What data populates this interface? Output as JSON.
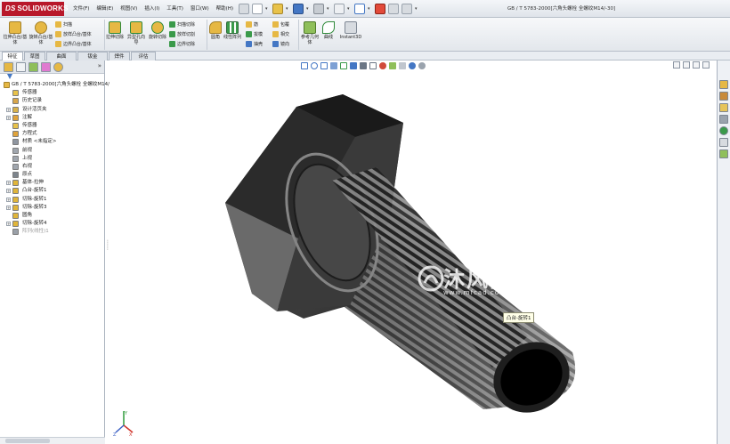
{
  "app": {
    "logo": "SOLIDWORKS",
    "logo_prefix": "DS",
    "window_title": "GB / T 5783-2000[六角头螺栓 全螺纹M14/-30]"
  },
  "menus": [
    "文件(F)",
    "编辑(E)",
    "视图(V)",
    "插入(I)",
    "工具(T)",
    "窗口(W)",
    "帮助(H)"
  ],
  "ribbon": {
    "extrude_boss": "拉伸凸台/基体",
    "revolve_boss": "旋转凸台/基体",
    "sweep": "扫描",
    "loft": "放样凸台/基体",
    "boundary_boss": "边界凸台/基体",
    "extrude_cut": "拉伸切除",
    "hole_wizard": "异型孔向导",
    "revolve_cut": "旋转切除",
    "swept_cut": "扫描切除",
    "lofted_cut": "放样切割",
    "boundary_cut": "边界切除",
    "fillet": "圆角",
    "linear_pattern": "线性阵列",
    "rib": "筋",
    "draft": "拔模",
    "shell": "抽壳",
    "wrap": "包覆",
    "intersect": "相交",
    "mirror": "镜向",
    "ref_geometry": "参考几何体",
    "curves": "曲线",
    "instant3d": "Instant3D"
  },
  "tabs": [
    "特征",
    "草图",
    "曲面",
    "钣金",
    "焊件",
    "评估"
  ],
  "tree": {
    "root": "GB / T 5783-2000[六角头螺栓 全螺纹M14/-30]",
    "items": [
      {
        "label": "传感器",
        "expandable": false,
        "icon_color": "#e8c24a"
      },
      {
        "label": "历史记录",
        "expandable": false,
        "icon_color": "#d9a64a"
      },
      {
        "label": "设计活页夹",
        "expandable": true,
        "icon_color": "#d9b24a"
      },
      {
        "label": "注解",
        "expandable": true,
        "icon_color": "#e0a33a"
      },
      {
        "label": "传感器",
        "expandable": false,
        "icon_color": "#e8c24a"
      },
      {
        "label": "方程式",
        "expandable": false,
        "icon_color": "#e0a33a"
      },
      {
        "label": "材质 <未指定>",
        "expandable": false,
        "icon_color": "#8f96a0"
      },
      {
        "label": "前视",
        "expandable": false,
        "icon_color": "#a0a6ae"
      },
      {
        "label": "上视",
        "expandable": false,
        "icon_color": "#a0a6ae"
      },
      {
        "label": "右视",
        "expandable": false,
        "icon_color": "#a0a6ae"
      },
      {
        "label": "原点",
        "expandable": false,
        "icon_color": "#7d848c"
      },
      {
        "label": "基体-拉伸",
        "expandable": true,
        "icon_color": "#e0b53a"
      },
      {
        "label": "凸台-旋转1",
        "expandable": true,
        "icon_color": "#e0b53a"
      },
      {
        "label": "切除-旋转1",
        "expandable": true,
        "icon_color": "#e0b53a"
      },
      {
        "label": "切除-旋转3",
        "expandable": true,
        "icon_color": "#e0b53a"
      },
      {
        "label": "圆角",
        "expandable": false,
        "icon_color": "#e0b53a"
      },
      {
        "label": "切除-旋转4",
        "expandable": true,
        "icon_color": "#e0b53a"
      },
      {
        "label": "阵列(线性)1",
        "expandable": false,
        "icon_color": "#9aa0a8",
        "dim": true
      }
    ]
  },
  "viewport": {
    "callout": "凸台-旋转1",
    "watermark": "沐风网",
    "watermark_url": "www.mfcad.com"
  },
  "colors": {
    "logo_red": "#b8182a",
    "accent_blue": "#4477c4",
    "model_dark": "#2f2f2f",
    "model_light": "#c9c9c9"
  }
}
